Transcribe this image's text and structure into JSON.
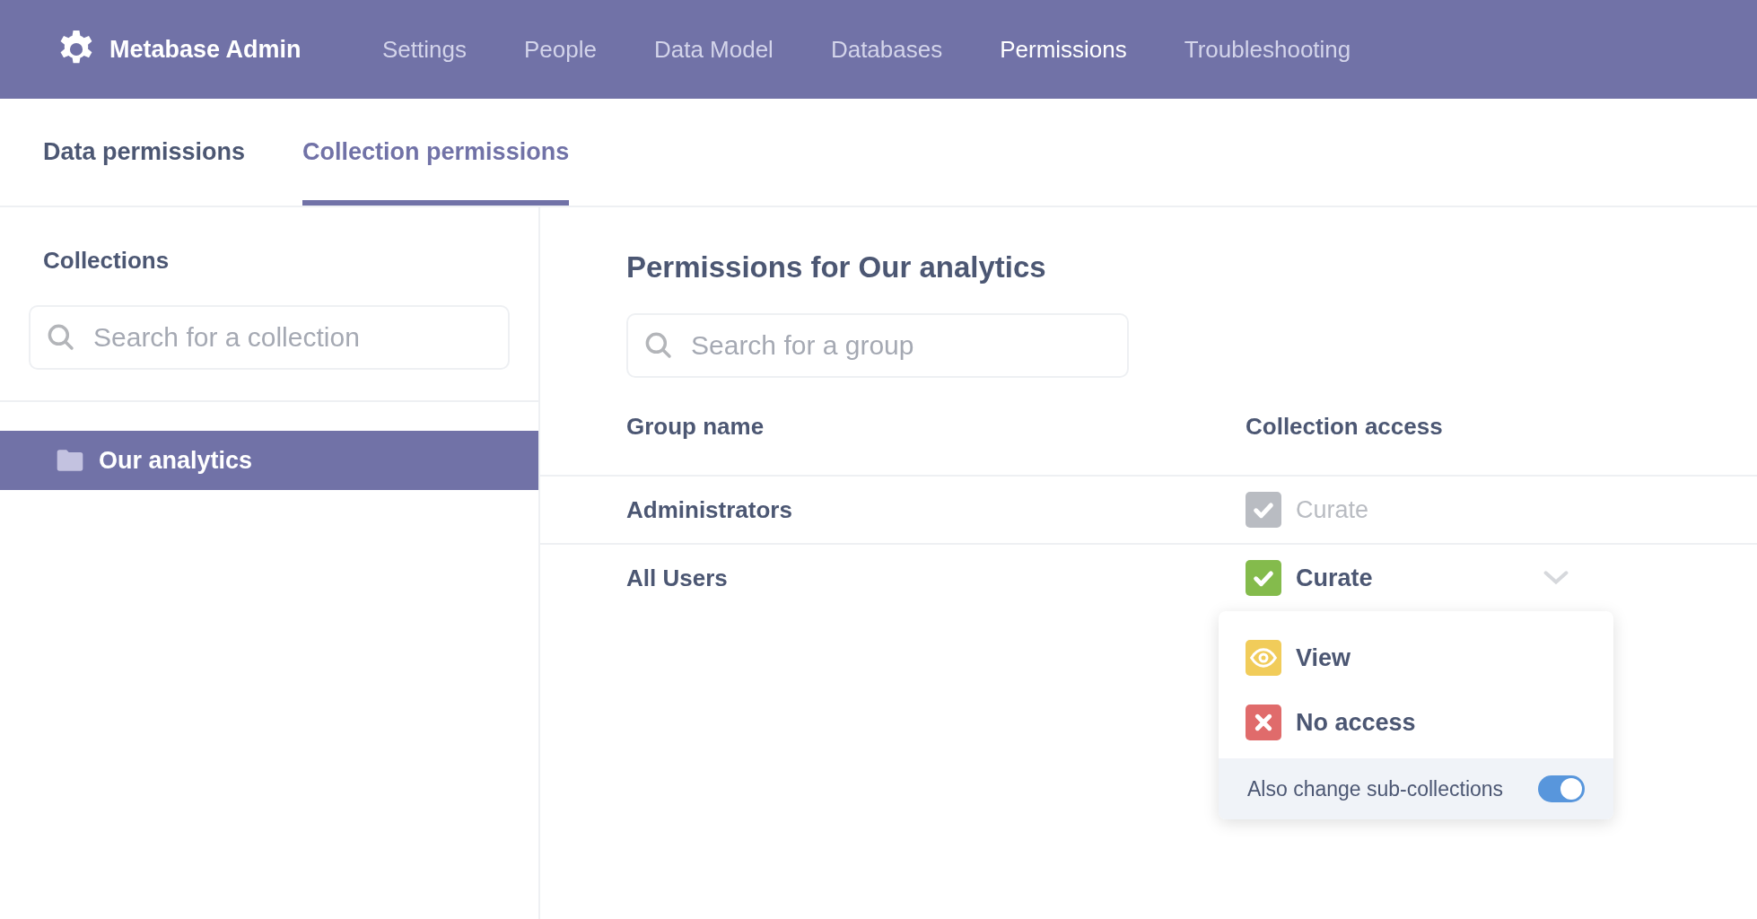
{
  "app": {
    "title": "Metabase Admin"
  },
  "nav": [
    {
      "label": "Settings",
      "selected": false
    },
    {
      "label": "People",
      "selected": false
    },
    {
      "label": "Data Model",
      "selected": false
    },
    {
      "label": "Databases",
      "selected": false
    },
    {
      "label": "Permissions",
      "selected": true
    },
    {
      "label": "Troubleshooting",
      "selected": false
    }
  ],
  "tabs": [
    {
      "label": "Data permissions",
      "selected": false
    },
    {
      "label": "Collection permissions",
      "selected": true
    }
  ],
  "sidebar": {
    "title": "Collections",
    "search": {
      "placeholder": "Search for a collection"
    },
    "items": [
      {
        "label": "Our analytics",
        "selected": true
      }
    ]
  },
  "main": {
    "title": "Permissions for Our analytics",
    "search": {
      "placeholder": "Search for a group"
    },
    "columns": [
      "Group name",
      "Collection access"
    ],
    "rows": [
      {
        "group": "Administrators",
        "access": {
          "kind": "curate",
          "label": "Curate"
        },
        "disabled": true,
        "expanded": false
      },
      {
        "group": "All Users",
        "access": {
          "kind": "curate",
          "label": "Curate"
        },
        "disabled": false,
        "expanded": true
      }
    ],
    "dropdown": {
      "options": [
        {
          "kind": "view",
          "label": "View"
        },
        {
          "kind": "no_access",
          "label": "No access"
        }
      ],
      "footer": {
        "label": "Also change sub-collections",
        "on": true
      }
    }
  }
}
